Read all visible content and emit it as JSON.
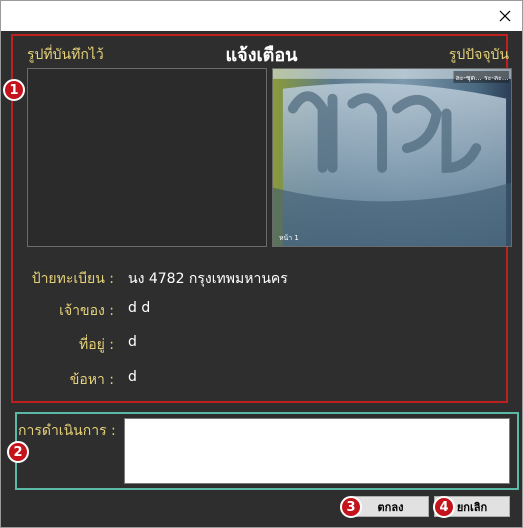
{
  "window": {
    "close_glyph": "✕"
  },
  "header": {
    "saved_image_label": "รูปที่บันทึกไว้",
    "title": "แจ้งเตือน",
    "current_image_label": "รูปปัจจุบัน"
  },
  "current_image": {
    "overlay_top_right": "ละ-ชุด... ระ-ละ...",
    "overlay_bottom_left": "หน้า 1"
  },
  "details": {
    "plate_label": "ป้ายทะเบียน :",
    "plate_value": "นง 4782 กรุงเทพมหานคร",
    "owner_label": "เจ้าของ :",
    "owner_value": "d d",
    "address_label": "ที่อยู่ :",
    "address_value": "d",
    "charge_label": "ข้อหา :",
    "charge_value": "d"
  },
  "action": {
    "label": "การดำเนินการ :",
    "value": ""
  },
  "buttons": {
    "ok_label": "ตกลง",
    "cancel_label": "ยกเลิก"
  },
  "markers": [
    "1",
    "2",
    "3",
    "4"
  ],
  "colors": {
    "background": "#2e2e2e",
    "label_yellow": "#e6d27a",
    "panel_red": "#c01f1f",
    "panel_cyan": "#5bb9a6",
    "marker_red": "#c4131a"
  }
}
